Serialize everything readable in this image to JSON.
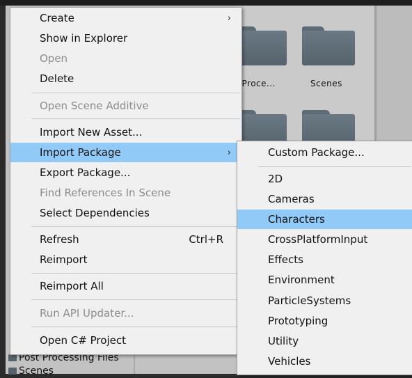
{
  "context_menu": {
    "items": [
      {
        "label": "Create",
        "submenu": true,
        "disabled": false
      },
      {
        "label": "Show in Explorer",
        "disabled": false
      },
      {
        "label": "Open",
        "disabled": true
      },
      {
        "label": "Delete",
        "disabled": false
      },
      {
        "label": "Open Scene Additive",
        "disabled": true
      },
      {
        "label": "Import New Asset...",
        "disabled": false
      },
      {
        "label": "Import Package",
        "submenu": true,
        "highlighted": true,
        "disabled": false
      },
      {
        "label": "Export Package...",
        "disabled": false
      },
      {
        "label": "Find References In Scene",
        "disabled": true
      },
      {
        "label": "Select Dependencies",
        "disabled": false
      },
      {
        "label": "Refresh",
        "shortcut": "Ctrl+R",
        "disabled": false
      },
      {
        "label": "Reimport",
        "disabled": false
      },
      {
        "label": "Reimport All",
        "disabled": false
      },
      {
        "label": "Run API Updater...",
        "disabled": true
      },
      {
        "label": "Open C# Project",
        "disabled": false
      }
    ],
    "submenu_arrow": "›"
  },
  "import_package_submenu": {
    "items": [
      {
        "label": "Custom Package..."
      },
      {
        "label": "2D"
      },
      {
        "label": "Cameras"
      },
      {
        "label": "Characters",
        "highlighted": true
      },
      {
        "label": "CrossPlatformInput"
      },
      {
        "label": "Effects"
      },
      {
        "label": "Environment"
      },
      {
        "label": "ParticleSystems"
      },
      {
        "label": "Prototyping"
      },
      {
        "label": "Utility"
      },
      {
        "label": "Vehicles"
      }
    ]
  },
  "asset_browser": {
    "folders": [
      {
        "label": "t Proce..."
      },
      {
        "label": "Scenes"
      }
    ]
  },
  "project_tree": {
    "items": [
      {
        "label": "Post Processing Files"
      },
      {
        "label": "Scenes"
      }
    ]
  },
  "colors": {
    "highlight": "#91c9f7",
    "menu_bg": "#f0f0f0",
    "disabled_text": "#8c8c8c",
    "folder": "#5d6b74"
  }
}
